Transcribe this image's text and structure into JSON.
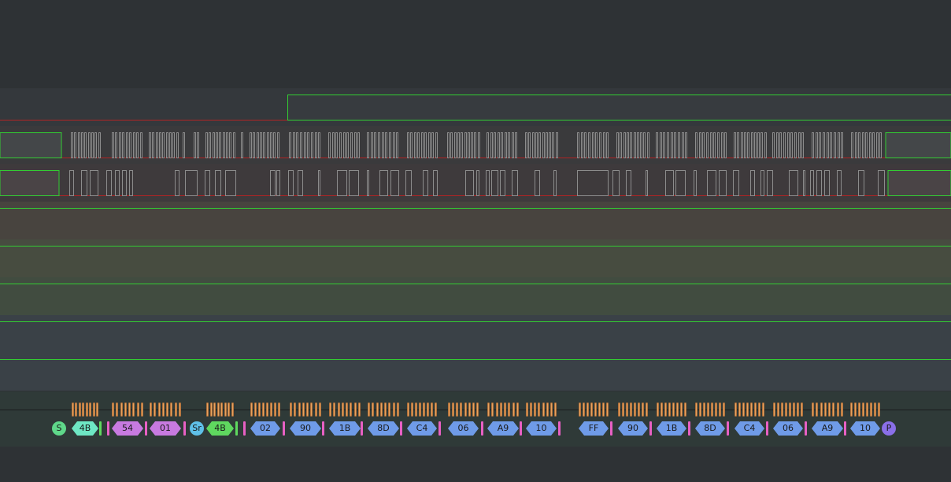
{
  "colors": {
    "background": "#2e3235",
    "edge_green": "#33cc33",
    "low_red": "#b02424",
    "pulse_gray": "#8c8c8c",
    "bit_orange": "#e7a35f",
    "address_write": "#6ee7c4",
    "address_read": "#5fd85f",
    "read_data": "#c77ae0",
    "data": "#6f9be8",
    "start": "#5fd88a",
    "repeated_start": "#5fc0e8",
    "stop": "#8a6fe8",
    "ack": "#e860c4"
  },
  "icons": {
    "bit_marker": "bit-sample-icon",
    "ack_marker": "ack-icon"
  },
  "channel_bands": [
    {
      "color": "#34383c"
    },
    {
      "color": "#3a3a3c"
    },
    {
      "color": "#3e3a3c"
    },
    {
      "color": "#48443f"
    },
    {
      "color": "#474c40"
    },
    {
      "color": "#414c40"
    },
    {
      "color": "#3a4147"
    },
    {
      "color": "#3a4147"
    }
  ],
  "decoder": {
    "start_label": "S",
    "repeated_start_label": "Sr",
    "stop_label": "P",
    "frames": [
      {
        "label": "4B",
        "kind": "address_write"
      },
      {
        "label": "54",
        "kind": "read_data"
      },
      {
        "label": "01",
        "kind": "read_data"
      },
      {
        "label": "4B",
        "kind": "address_read"
      },
      {
        "label": "02",
        "kind": "data"
      },
      {
        "label": "90",
        "kind": "data"
      },
      {
        "label": "1B",
        "kind": "data"
      },
      {
        "label": "8D",
        "kind": "data"
      },
      {
        "label": "C4",
        "kind": "data"
      },
      {
        "label": "06",
        "kind": "data"
      },
      {
        "label": "A9",
        "kind": "data"
      },
      {
        "label": "10",
        "kind": "data"
      },
      {
        "label": "FF",
        "kind": "data"
      },
      {
        "label": "90",
        "kind": "data"
      },
      {
        "label": "1B",
        "kind": "data"
      },
      {
        "label": "8D",
        "kind": "data"
      },
      {
        "label": "C4",
        "kind": "data"
      },
      {
        "label": "06",
        "kind": "data"
      },
      {
        "label": "A9",
        "kind": "data"
      },
      {
        "label": "10",
        "kind": "data"
      }
    ]
  }
}
